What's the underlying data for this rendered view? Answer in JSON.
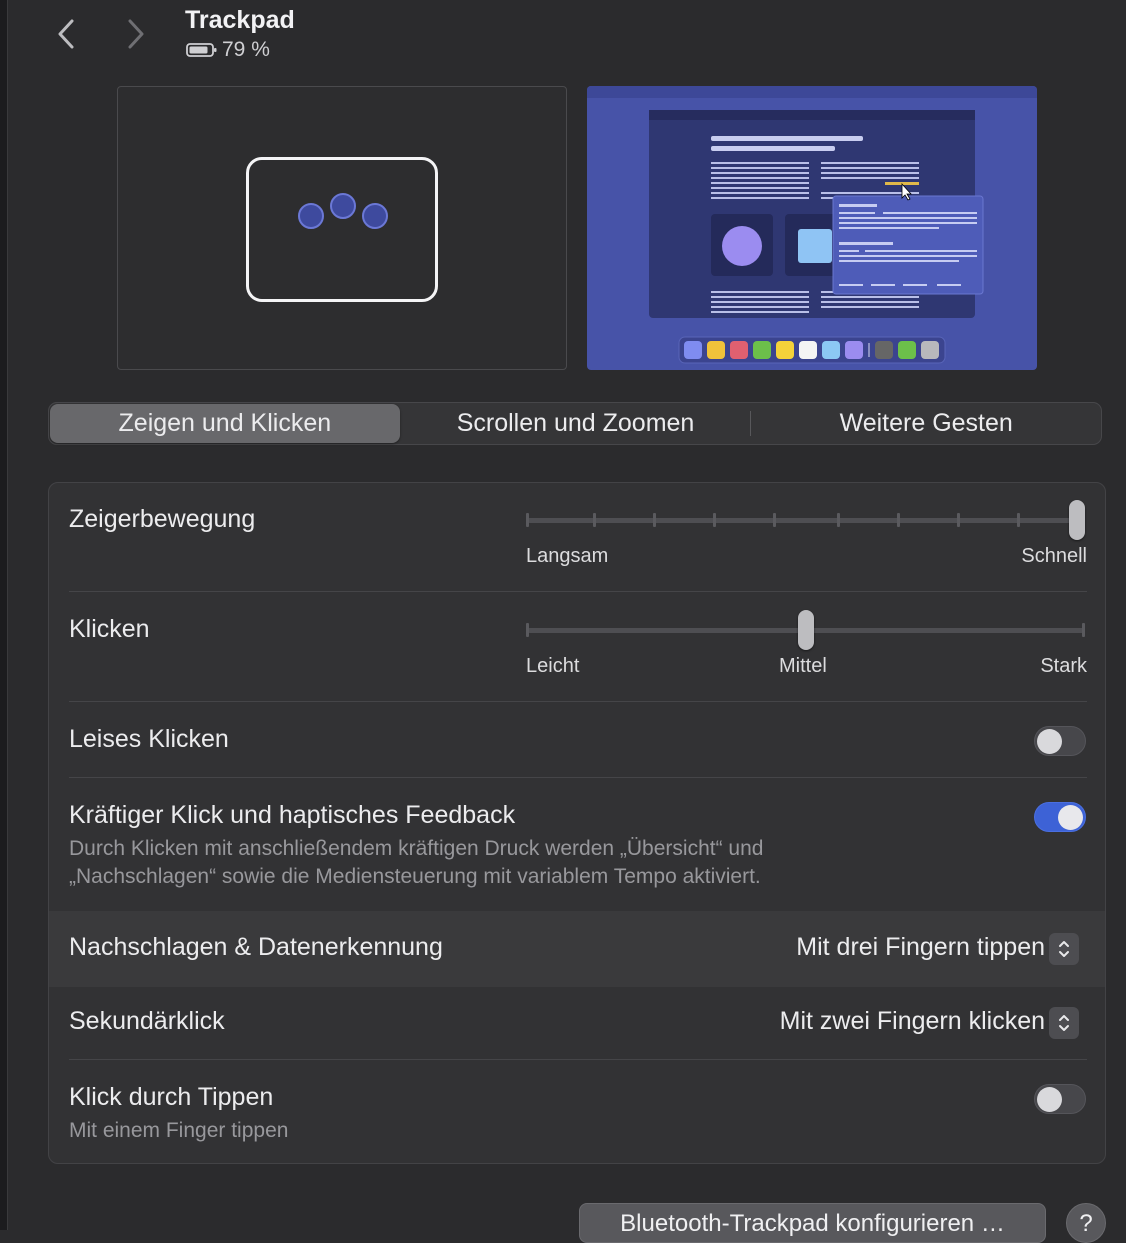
{
  "header": {
    "title": "Trackpad",
    "battery": "79 %"
  },
  "tabs": [
    {
      "label": "Zeigen und Klicken",
      "active": true
    },
    {
      "label": "Scrollen und Zoomen",
      "active": false
    },
    {
      "label": "Weitere Gesten",
      "active": false
    }
  ],
  "settings": {
    "pointer_speed": {
      "label": "Zeigerbewegung",
      "min_label": "Langsam",
      "max_label": "Schnell",
      "level": 1.0
    },
    "click": {
      "label": "Klicken",
      "left_label": "Leicht",
      "mid_label": "Mittel",
      "right_label": "Stark",
      "level": 0.5
    },
    "silent_click": {
      "label": "Leises Klicken",
      "enabled": false
    },
    "force_click": {
      "label": "Kräftiger Klick und haptisches Feedback",
      "description_line1": "Durch Klicken mit anschließendem kräftigen Druck werden „Übersicht“ und",
      "description_line2": "„Nachschlagen“ sowie die Mediensteuerung mit variablem Tempo aktiviert.",
      "enabled": true
    },
    "lookup": {
      "label": "Nachschlagen & Datenerkennung",
      "value": "Mit drei Fingern tippen"
    },
    "secondary_click": {
      "label": "Sekundärklick",
      "value": "Mit zwei Fingern klicken"
    },
    "tap_to_click": {
      "label": "Klick durch Tippen",
      "description": "Mit einem Finger tippen",
      "enabled": false
    }
  },
  "buttons": {
    "bluetooth": "Bluetooth-Trackpad konfigurieren …",
    "help": "?"
  },
  "colors": {
    "accent": "#3d62d6",
    "preview_bg": "#4753a8"
  }
}
